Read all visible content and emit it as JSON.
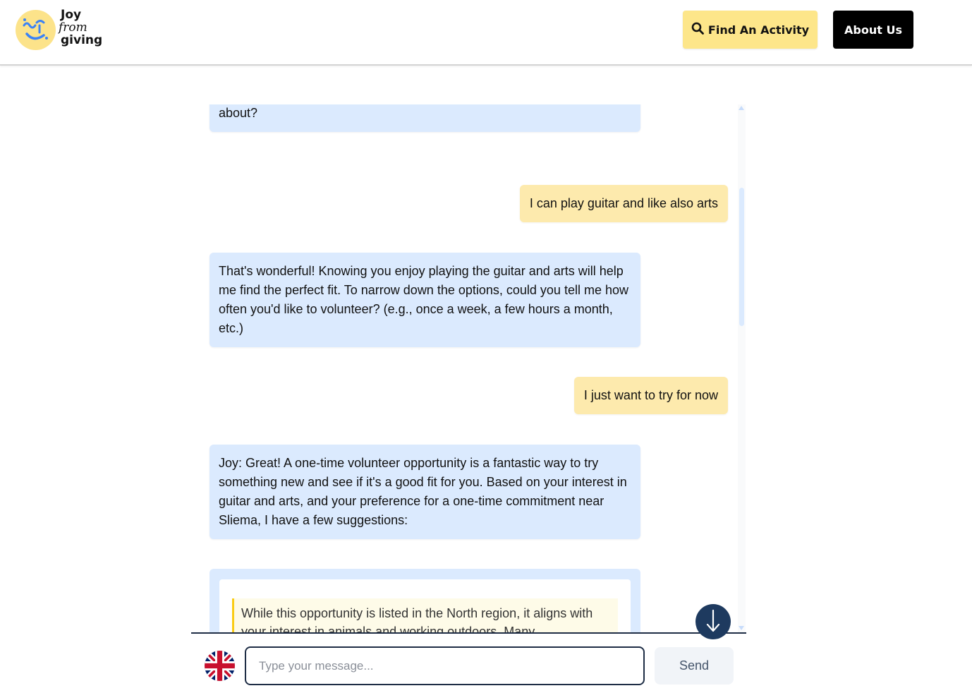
{
  "brand": {
    "line1": "Joy",
    "line2": "from",
    "line3": "giving"
  },
  "nav": {
    "find_activity": "Find An Activity",
    "about_us": "About Us"
  },
  "messages": [
    {
      "role": "bot",
      "text": "To make sure I find activities you'll enjoy among the volunteering opportunities near Sliema, could you tell me what you're passionate about?"
    },
    {
      "role": "user",
      "text": "I can play guitar and like also arts"
    },
    {
      "role": "bot",
      "text": "That's wonderful! Knowing you enjoy playing the guitar and arts will help me find the perfect fit. To narrow down the options, could you tell me how often you'd like to volunteer? (e.g., once a week, a few hours a month, etc.)"
    },
    {
      "role": "user",
      "text": "I just want to try for now"
    },
    {
      "role": "bot",
      "text": "Joy: Great! A one-time volunteer opportunity is a fantastic way to try something new and see if it's a good fit for you. Based on your interest in guitar and arts, and your preference for a one-time commitment near Sliema, I have a few suggestions:"
    }
  ],
  "suggestion_card": {
    "note": "While this opportunity is listed in the North region, it aligns with your interest in animals and working outdoors. Many opportunities"
  },
  "composer": {
    "placeholder": "Type your message...",
    "value": "",
    "send_label": "Send",
    "language_icon": "uk-flag-icon"
  },
  "colors": {
    "bot_bubble": "#dbeafe",
    "user_bubble": "#fdeaad",
    "find_button": "#fde68a",
    "about_button": "#000000",
    "accent_navy": "#1e3a5f"
  }
}
